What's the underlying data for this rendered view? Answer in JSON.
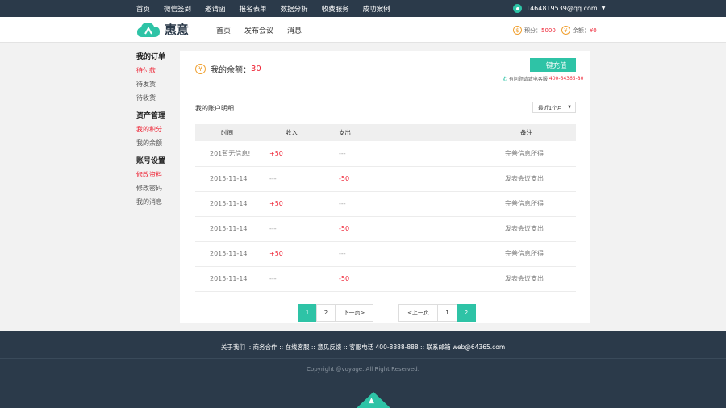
{
  "topnav": [
    "首页",
    "微信签到",
    "邀请函",
    "报名表单",
    "数据分析",
    "收费服务",
    "成功案例"
  ],
  "user": {
    "email": "1464819539@qq.com"
  },
  "brand": {
    "name": "惠意"
  },
  "mainnav": [
    "首页",
    "发布会议",
    "消息"
  ],
  "header_stats": {
    "points_label": "积分：",
    "points_value": "5000",
    "balance_label": "余额：",
    "balance_value": "¥0",
    "coin_symbol": "$",
    "yen_symbol": "¥"
  },
  "sidebar": [
    {
      "title": "我的订单",
      "items": [
        {
          "label": "待付款",
          "active": true
        },
        {
          "label": "待发货",
          "active": false
        },
        {
          "label": "待收货",
          "active": false
        }
      ]
    },
    {
      "title": "资产管理",
      "items": [
        {
          "label": "我的积分",
          "active": true
        },
        {
          "label": "我的余额",
          "active": false
        }
      ]
    },
    {
      "title": "账号设置",
      "items": [
        {
          "label": "修改资料",
          "active": true
        },
        {
          "label": "修改密码",
          "active": false
        },
        {
          "label": "我的消息",
          "active": false
        }
      ]
    }
  ],
  "balance": {
    "label": "我的余额：",
    "amount": "30",
    "symbol": "¥"
  },
  "recharge_label": "一键充值",
  "hotline": {
    "text": "有问题请致电客服",
    "number": "400-64365-80"
  },
  "detail_title": "我的账户明细",
  "period": "最近1个月",
  "table": {
    "headers": [
      "时间",
      "收入",
      "支出",
      "备注"
    ],
    "rows": [
      {
        "time": "201暂无信息!",
        "income": "+50",
        "expense": "---",
        "note": "完善信息所得"
      },
      {
        "time": "2015-11-14",
        "income": "---",
        "expense": "-50",
        "note": "发表会议支出"
      },
      {
        "time": "2015-11-14",
        "income": "+50",
        "expense": "---",
        "note": "完善信息所得"
      },
      {
        "time": "2015-11-14",
        "income": "---",
        "expense": "-50",
        "note": "发表会议支出"
      },
      {
        "time": "2015-11-14",
        "income": "+50",
        "expense": "---",
        "note": "完善信息所得"
      },
      {
        "time": "2015-11-14",
        "income": "---",
        "expense": "-50",
        "note": "发表会议支出"
      }
    ]
  },
  "pager1": {
    "p1": "1",
    "p2": "2",
    "next": "下一页>"
  },
  "pager2": {
    "prev": "<上一页",
    "p1": "1",
    "p2": "2"
  },
  "footer": {
    "links": "关于我们  ::  商务合作  ::  在线客服  ::  意见反馈  ::  客服电话 400-8888-888  ::  联系邮箱 web@64365.com",
    "copyright": "Copyright @voyage. All Right Reserved."
  },
  "colors": {
    "accent": "#2ec3a6",
    "dark": "#2b3a4a",
    "red": "#e23333"
  }
}
